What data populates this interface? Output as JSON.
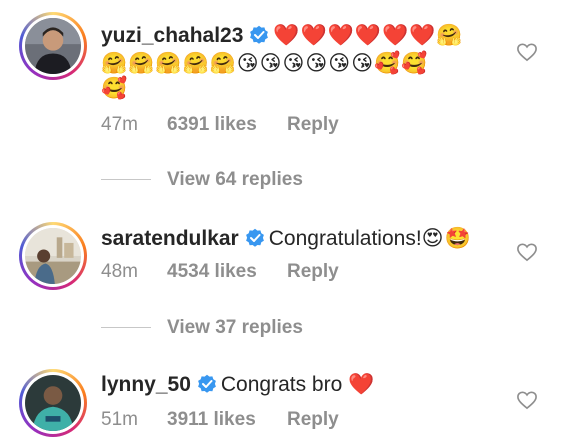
{
  "comments": [
    {
      "username": "yuzi_chahal23",
      "text": "",
      "emojis_line1": "❤️❤️❤️❤️❤️❤️🤗",
      "emojis_line2": "🤗🤗🤗🤗🤗😘😘😘😘😘😘🥰🥰",
      "emojis_line3": "🥰",
      "time": "47m",
      "likes": "6391 likes",
      "reply_label": "Reply",
      "view_replies": "View 64 replies",
      "avatar_icon": "profile-photo"
    },
    {
      "username": "saratendulkar",
      "text": "Congratulations!",
      "emojis_inline": "😍🤩",
      "time": "48m",
      "likes": "4534 likes",
      "reply_label": "Reply",
      "view_replies": "View 37 replies",
      "avatar_icon": "profile-photo"
    },
    {
      "username": "lynny_50",
      "text": "Congrats bro",
      "emojis_inline": "❤️",
      "time": "51m",
      "likes": "3911 likes",
      "reply_label": "Reply",
      "avatar_icon": "profile-photo"
    }
  ],
  "colors": {
    "verified_blue": "#3897f0",
    "meta_gray": "#8e8e8e",
    "text": "#262626"
  },
  "icons": {
    "verified": "verified-badge-icon",
    "like": "heart-outline-icon"
  }
}
